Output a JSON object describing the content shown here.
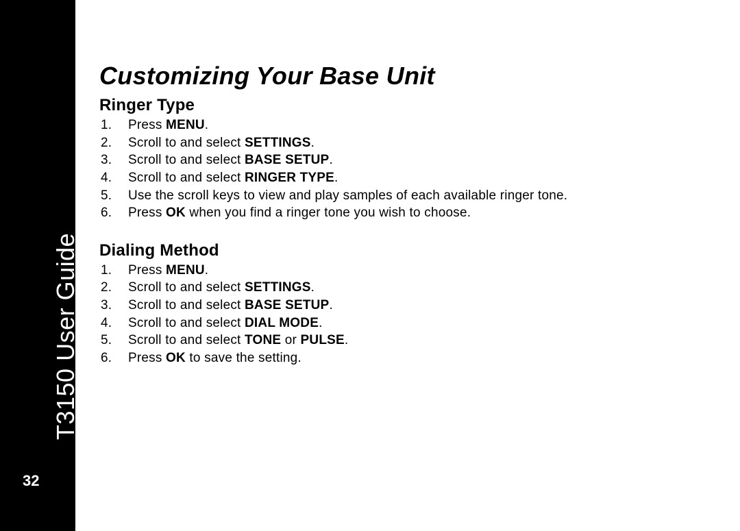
{
  "sidebar": {
    "title": "T3150 User Guide",
    "page_number": "32"
  },
  "main": {
    "title": "Customizing Your Base Unit",
    "sections": [
      {
        "heading": "Ringer Type",
        "steps": [
          {
            "pre": "Press ",
            "bold1": "MENU",
            "mid": "",
            "bold2": "",
            "post": "."
          },
          {
            "pre": "Scroll to and select ",
            "bold1": "SETTINGS",
            "mid": "",
            "bold2": "",
            "post": "."
          },
          {
            "pre": "Scroll to and select ",
            "bold1": "BASE SETUP",
            "mid": "",
            "bold2": "",
            "post": "."
          },
          {
            "pre": "Scroll to and select ",
            "bold1": "RINGER TYPE",
            "mid": "",
            "bold2": "",
            "post": "."
          },
          {
            "pre": "Use the scroll keys to view and play samples of each available ringer tone.",
            "bold1": "",
            "mid": "",
            "bold2": "",
            "post": ""
          },
          {
            "pre": "Press ",
            "bold1": "OK",
            "mid": " when you find a ringer tone you wish to choose.",
            "bold2": "",
            "post": ""
          }
        ]
      },
      {
        "heading": "Dialing Method",
        "steps": [
          {
            "pre": "Press ",
            "bold1": "MENU",
            "mid": "",
            "bold2": "",
            "post": "."
          },
          {
            "pre": "Scroll to and select ",
            "bold1": "SETTINGS",
            "mid": "",
            "bold2": "",
            "post": "."
          },
          {
            "pre": "Scroll to and select ",
            "bold1": "BASE SETUP",
            "mid": "",
            "bold2": "",
            "post": "."
          },
          {
            "pre": "Scroll to and select ",
            "bold1": "DIAL MODE",
            "mid": "",
            "bold2": "",
            "post": "."
          },
          {
            "pre": "Scroll to and select ",
            "bold1": "TONE",
            "mid": " or ",
            "bold2": "PULSE",
            "post": "."
          },
          {
            "pre": "Press ",
            "bold1": "OK",
            "mid": " to save the setting.",
            "bold2": "",
            "post": ""
          }
        ]
      }
    ]
  }
}
